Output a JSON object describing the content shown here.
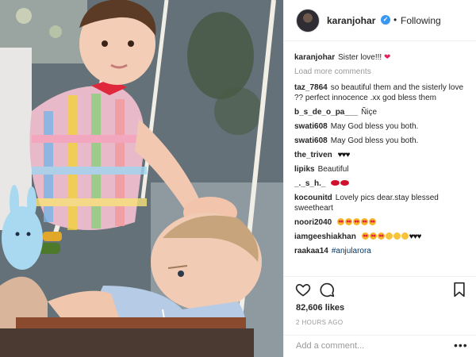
{
  "post": {
    "username": "karanjohar",
    "follow_status": "Following",
    "separator": "•",
    "verified_mark": "✓",
    "photo_label": "Two toddlers on a rope swing"
  },
  "caption": {
    "user": "karanjohar",
    "text": "Sister love!!!"
  },
  "load_more": "Load more comments",
  "comments": [
    {
      "user": "taz_7864",
      "text": "so beautiful them and the sisterly love ?? perfect innocence .xx god bless them"
    },
    {
      "user": "b_s_de_o_pa___",
      "text": "Ñiçe"
    },
    {
      "user": "swati608",
      "text": "May God bless you both."
    },
    {
      "user": "swati608",
      "text": "May God bless you both."
    },
    {
      "user": "the_triven",
      "text": ""
    },
    {
      "user": "lipiks",
      "text": "Beautiful"
    },
    {
      "user": "_._s_h._",
      "text": ""
    },
    {
      "user": "kocounitd",
      "text": "Lovely pics dear.stay blessed sweetheart"
    },
    {
      "user": "noori2040",
      "text": ""
    },
    {
      "user": "iamgeeshiakhan",
      "text": ""
    },
    {
      "user": "raakaa14",
      "text": "#anjularora"
    }
  ],
  "likes": "82,606 likes",
  "timestamp": "2 HOURS AGO",
  "add_comment": {
    "placeholder": "Add a comment..."
  },
  "icons": [
    "heart-icon",
    "comment-icon",
    "bookmark-icon",
    "more-icon",
    "verified-icon"
  ],
  "colors": {
    "verified": "#3897f0",
    "link": "#003569",
    "muted": "#999999",
    "heart": "#e0245e"
  }
}
